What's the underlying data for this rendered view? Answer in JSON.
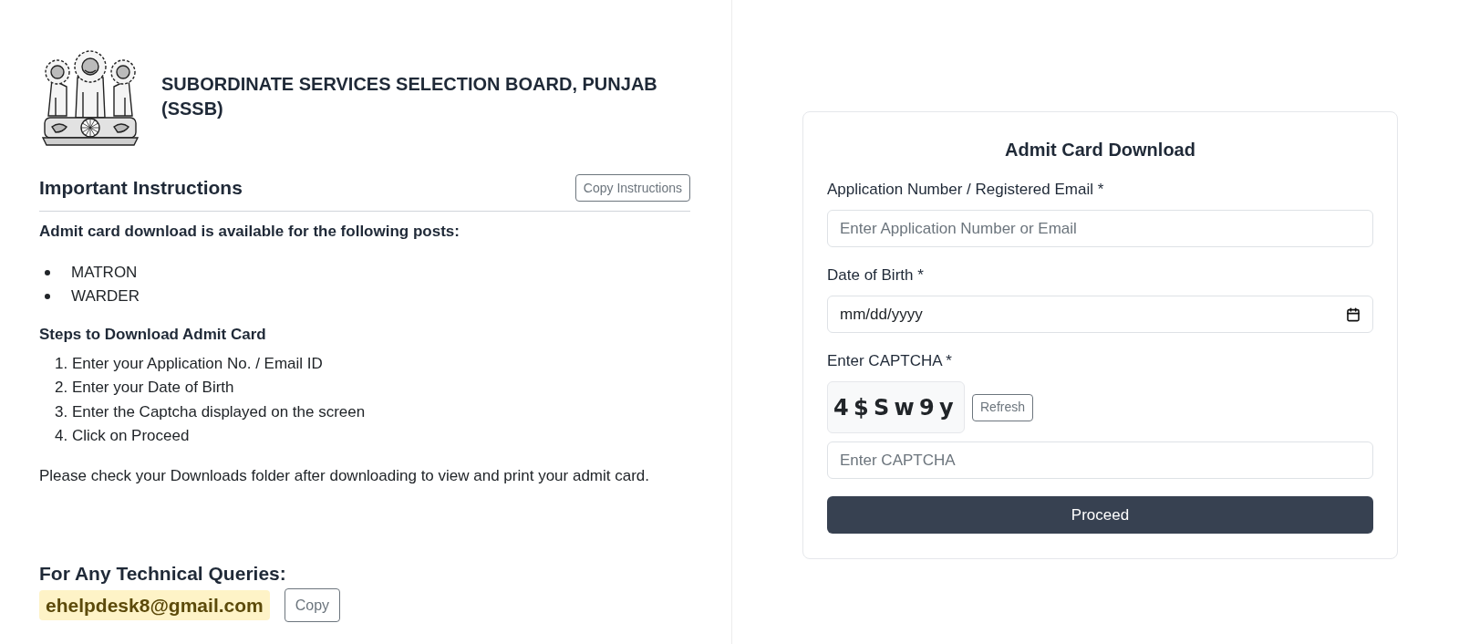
{
  "header": {
    "title": "SUBORDINATE SERVICES SELECTION BOARD, PUNJAB (SSSB)"
  },
  "instructions": {
    "heading": "Important Instructions",
    "copy_button": "Copy Instructions",
    "intro": "Admit card download is available for the following posts:",
    "posts": [
      "MATRON",
      "WARDER"
    ],
    "steps_heading": "Steps to Download Admit Card",
    "steps": [
      "1. Enter your Application No. / Email ID",
      "2. Enter your Date of Birth",
      "3. Enter the Captcha displayed on the screen",
      "4. Click on Proceed"
    ],
    "note": "Please check your Downloads folder after downloading to view and print your admit card."
  },
  "contact": {
    "heading": "For Any Technical Queries:",
    "email": "ehelpdesk8@gmail.com",
    "copy_button": "Copy"
  },
  "form": {
    "title": "Admit Card Download",
    "fields": [
      {
        "kind": "text",
        "label": "Application Number / Registered Email *",
        "placeholder": "Enter Application Number or Email"
      },
      {
        "kind": "date",
        "label": "Date of Birth *",
        "placeholder": "mm/dd/yyyy"
      },
      {
        "kind": "captcha",
        "label": "Enter CAPTCHA *",
        "captcha": "4$Sw9y",
        "refresh_button": "Refresh",
        "placeholder": "Enter CAPTCHA"
      }
    ],
    "submit_button": "Proceed"
  }
}
